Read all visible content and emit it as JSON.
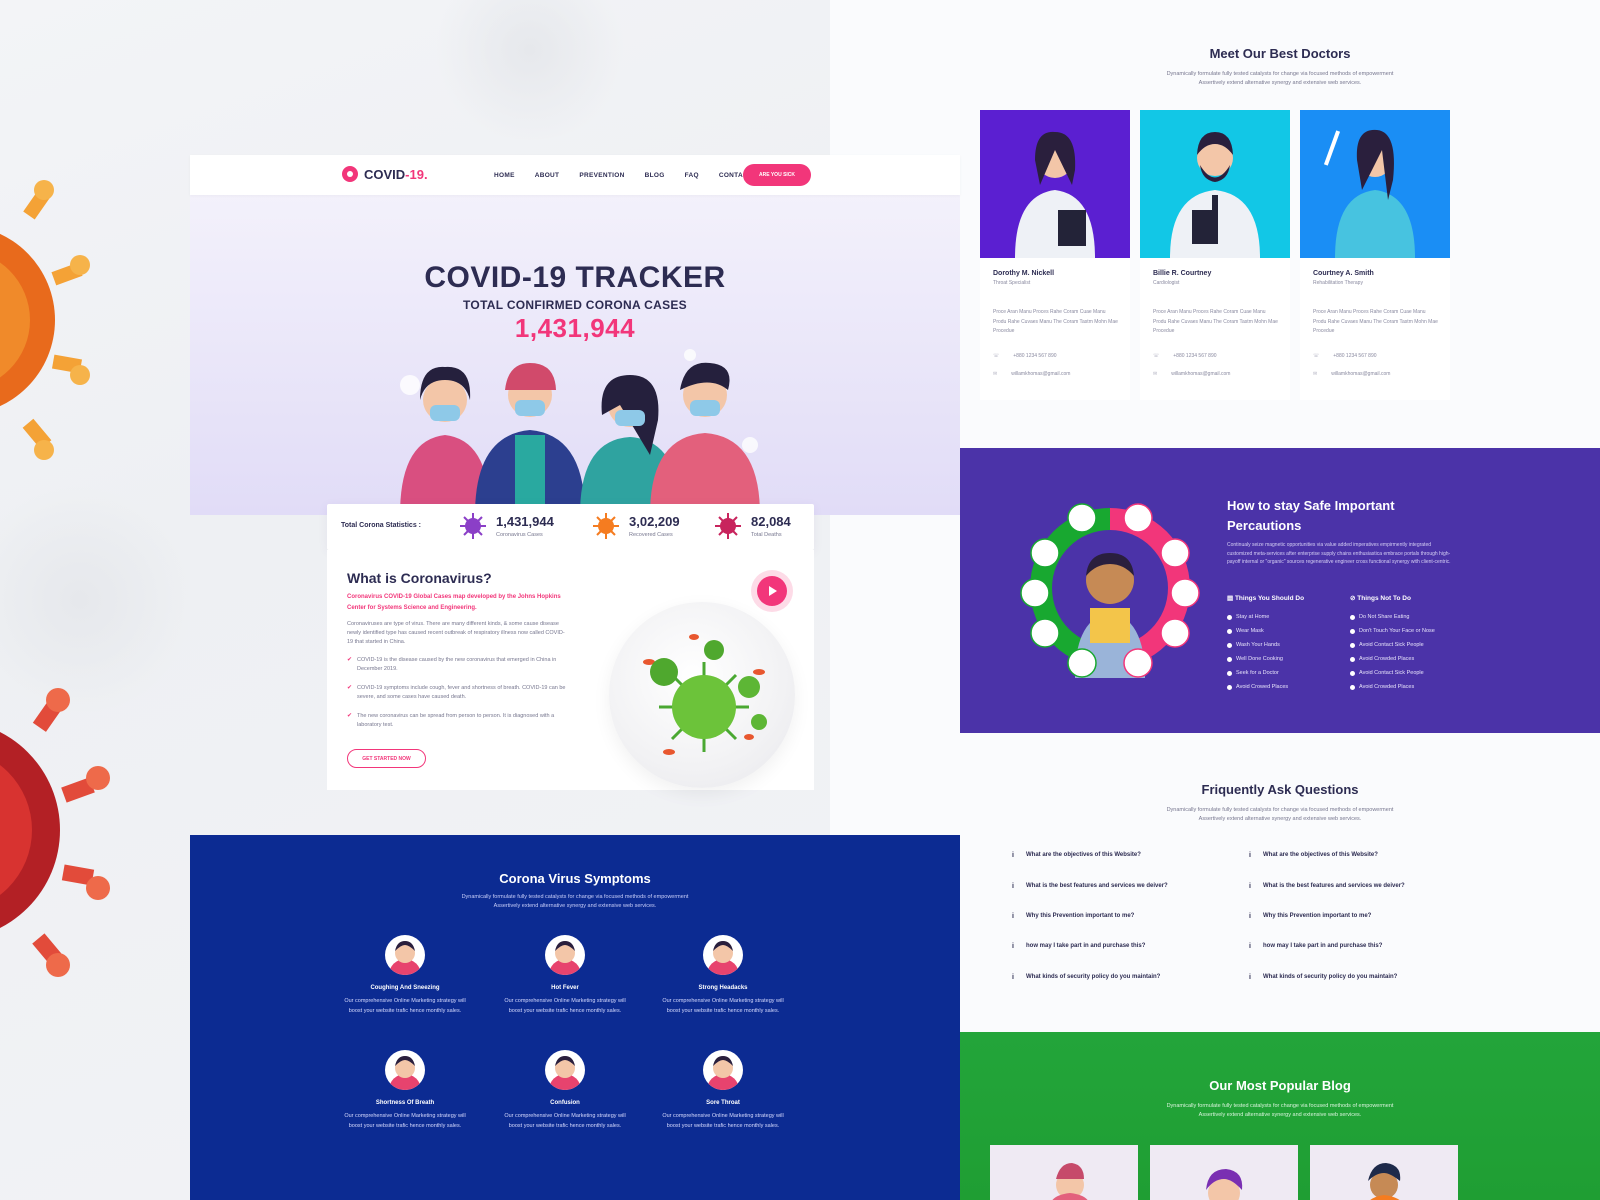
{
  "brand": {
    "name": "COVID",
    "suffix": "-19.",
    "accent": "#f2367a",
    "navy": "#2d2c52"
  },
  "nav": {
    "items": [
      "HOME",
      "ABOUT",
      "PREVENTION",
      "BLOG",
      "FAQ",
      "CONTACT"
    ],
    "cta": "ARE YOU SICK"
  },
  "hero": {
    "title": "COVID-19 TRACKER",
    "subtitle": "TOTAL CONFIRMED CORONA CASES",
    "count": "1,431,944"
  },
  "stats": {
    "label": "Total Corona Statistics :",
    "items": [
      {
        "value": "1,431,944",
        "label": "Coronavirus Cases",
        "color": "#8b3fc7"
      },
      {
        "value": "3,02,209",
        "label": "Recovered Cases",
        "color": "#f57c20"
      },
      {
        "value": "82,084",
        "label": "Total Deaths",
        "color": "#c8245d"
      }
    ]
  },
  "whatis": {
    "title": "What is Coronavirus?",
    "highlight": "Coronavirus COVID-19 Global Cases map developed by the Johns Hopkins Center for Systems Science and Engineering.",
    "body": "Coronaviruses are type of virus. There are many different kinds, & some cause disease newly identified type has caused recent outbreak of respiratory illness now called COVID-19 that started in China.",
    "checks": [
      "COVID-19 is the disease caused by the new coronavirus that emerged in China in December 2019.",
      "COVID-19 symptoms include cough, fever and shortness of breath. COVID-19 can be severe, and some cases have caused death.",
      "The new coronavirus can be spread from person to person. It is diagnosed with a laboratory test."
    ],
    "button": "GET STARTED NOW"
  },
  "symptoms": {
    "title": "Corona Virus Symptoms",
    "subtitle_1": "Dynamically formulate fully tested catalysts for change via focused methods of empowerment",
    "subtitle_2": "Assertively extend alternative synergy and extensive web services.",
    "items": [
      {
        "name": "Coughing And Sneezing",
        "desc": "Our comprehensive Online Marketing strategy will boost your website trafic hence monthly sales."
      },
      {
        "name": "Hot Fever",
        "desc": "Our comprehensive Online Marketing strategy will boost your website trafic hence monthly sales."
      },
      {
        "name": "Strong Headacks",
        "desc": "Our comprehensive Online Marketing strategy will boost your website trafic hence monthly sales."
      },
      {
        "name": "Shortness Of Breath",
        "desc": "Our comprehensive Online Marketing strategy will boost your website trafic hence monthly sales."
      },
      {
        "name": "Confusion",
        "desc": "Our comprehensive Online Marketing strategy will boost your website trafic hence monthly sales."
      },
      {
        "name": "Sore Throat",
        "desc": "Our comprehensive Online Marketing strategy will boost your website trafic hence monthly sales."
      }
    ]
  },
  "doctors": {
    "title": "Meet Our Best Doctors",
    "subtitle_1": "Dynamically formulate fully tested catalysts for change via focused methods of empowerment",
    "subtitle_2": "Assertively extend alternative synergy and extensive web services.",
    "items": [
      {
        "name": "Dorothy M. Nickell",
        "role": "Throat Specialist",
        "bio": "Proce Aran Manu Proces Rahe Coram Cuae Manu Produ Rahe Cuvaes Manu The Coram Tastm Mohn Mae Procedue",
        "phone": "+880 1234 567 890",
        "email": "willamkhomas@gmail.com",
        "bg": "#5b1fd1"
      },
      {
        "name": "Billie R. Courtney",
        "role": "Cardiologist",
        "bio": "Proce Aran Manu Proces Rahe Coram Cuae Manu Produ Rahe Cuvaes Manu The Coram Tastm Mohn Mae Procedue",
        "phone": "+880 1234 567 890",
        "email": "willamkhomas@gmail.com",
        "bg": "#12c7e6"
      },
      {
        "name": "Courtney A. Smith",
        "role": "Rehabilitation Therapy",
        "bio": "Proce Aran Manu Proces Rahe Coram Cuae Manu Produ Rahe Cuvaes Manu The Coram Tastm Mohn Mae Procedue",
        "phone": "+880 1234 567 890",
        "email": "willamkhomas@gmail.com",
        "bg": "#1a8ef5"
      }
    ]
  },
  "safe": {
    "title": "How to stay Safe Important Percautions",
    "text": "Continualy seize magnetic opportunities via value added imperatives empirmently integrated customized meta-services after enterprise supply chains enthusiastica embrace portals through high-payoff internal or \"organic\" sources regenerative engineer cross functional synergy with client-centric.",
    "should_title": "Things You Should Do",
    "should": [
      "Stay at Home",
      "Wear Mask",
      "Wash Your Hands",
      "Well Done Cooking",
      "Seek for a Doctor",
      "Avoid Crowed Places"
    ],
    "not_title": "Things Not To Do",
    "not": [
      "Do Not Share Eating",
      "Don't Touch Your Face or Nose",
      "Avoid Contact Sick People",
      "Avoid Crowded Places",
      "Avoid Contact Sick People",
      "Avoid Crowded Places"
    ]
  },
  "faq": {
    "title": "Friquently Ask Questions",
    "subtitle_1": "Dynamically formulate fully tested catalysts for change via focused methods of empowerment",
    "subtitle_2": "Assertively extend alternative synergy and extensive web services.",
    "left": [
      "What are the objectives of this Website?",
      "What is the best features and services we deiver?",
      "Why this Prevention important to me?",
      "how may I take part in and purchase this?",
      "What kinds of security policy do you maintain?"
    ],
    "right": [
      "What are the objectives of this Website?",
      "What is the best features and services we deiver?",
      "Why this Prevention important to me?",
      "how may I take part in and purchase this?",
      "What kinds of security policy do you maintain?"
    ]
  },
  "blog": {
    "title": "Our Most Popular Blog",
    "subtitle_1": "Dynamically formulate fully tested catalysts for change via focused methods of empowerment",
    "subtitle_2": "Assertively extend alternative synergy and extensive web services."
  }
}
